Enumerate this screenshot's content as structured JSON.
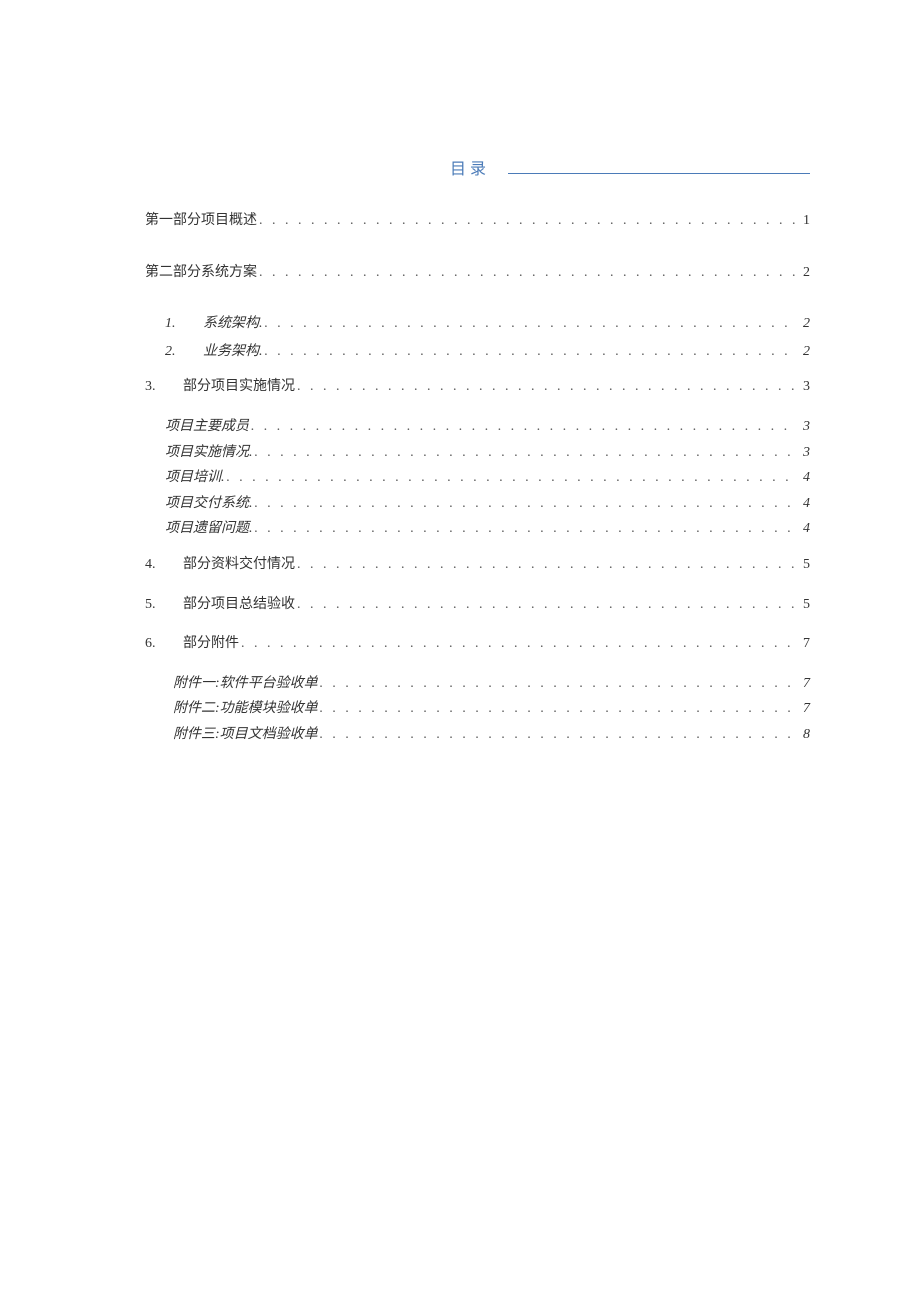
{
  "title": "目录",
  "entries": [
    {
      "style": "level-top",
      "num": "",
      "label": "第一部分项目概述",
      "page": "1"
    },
    {
      "style": "level-top group-lead",
      "num": "",
      "label": "第二部分系统方案",
      "page": "2"
    },
    {
      "style": "level1",
      "num": "1.",
      "label": "系统架构.",
      "page": "2"
    },
    {
      "style": "level1",
      "num": "2.",
      "label": "业务架构.",
      "page": "2"
    },
    {
      "style": "level0",
      "num": "3.",
      "label": "部分项目实施情况",
      "page": "3"
    },
    {
      "style": "level2",
      "num": "",
      "label": "项目主要成员",
      "page": "3"
    },
    {
      "style": "level2",
      "num": "",
      "label": "项目实施情况.",
      "page": "3"
    },
    {
      "style": "level2",
      "num": "",
      "label": "项目培训.",
      "page": "4"
    },
    {
      "style": "level2",
      "num": "",
      "label": "项目交付系统.",
      "page": "4"
    },
    {
      "style": "level2",
      "num": "",
      "label": "项目遗留问题.",
      "page": "4"
    },
    {
      "style": "level0",
      "num": "4.",
      "label": "部分资料交付情况",
      "page": "5"
    },
    {
      "style": "level0",
      "num": "5.",
      "label": "部分项目总结验收",
      "page": "5"
    },
    {
      "style": "level0",
      "num": "6.",
      "label": "部分附件",
      "page": "7"
    },
    {
      "style": "level2a",
      "num": "",
      "label": "附件一:软件平台验收单",
      "page": "7"
    },
    {
      "style": "level2a",
      "num": "",
      "label": "附件二:功能模块验收单",
      "page": "7"
    },
    {
      "style": "level2a",
      "num": "",
      "label": "附件三:项目文档验收单",
      "page": "8"
    }
  ]
}
